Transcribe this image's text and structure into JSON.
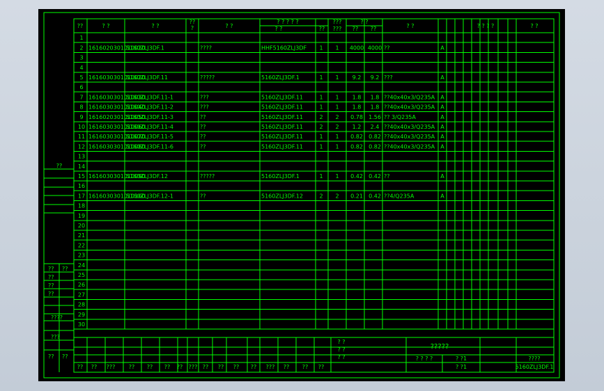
{
  "header": {
    "seq": "??",
    "code": "?  ?",
    "drawing_no": "?    ?",
    "qty_flag": "??\n?",
    "name": "?    ?",
    "assembly_top": "? ? ? ? ?",
    "assembly_sub_a": "?    ?",
    "assembly_sub_b": "??",
    "qty": "???\n???",
    "weight_top": "?    ?",
    "weight_single": "??",
    "weight_total": "??",
    "material": "?    ?",
    "extra": "?  ?  ?  ?",
    "remark": "?  ?"
  },
  "rows": [
    {
      "n": "1",
      "code": "",
      "drawing": "",
      "name": "",
      "asm": "",
      "q1": "",
      "q2": "",
      "w1": "",
      "w2": "",
      "mat": "",
      "cls": ""
    },
    {
      "n": "2",
      "code": "1616020301010020",
      "drawing": "5160ZLJ3DF.1",
      "name": "????",
      "asm": "HHF5160ZLJ3DF",
      "q1": "1",
      "q2": "1",
      "w1": "4000",
      "w2": "4000",
      "mat": "??",
      "cls": "A"
    },
    {
      "n": "3",
      "code": "",
      "drawing": "",
      "name": "",
      "asm": "",
      "q1": "",
      "q2": "",
      "w1": "",
      "w2": "",
      "mat": "",
      "cls": ""
    },
    {
      "n": "4",
      "code": "",
      "drawing": "",
      "name": "",
      "asm": "",
      "q1": "",
      "q2": "",
      "w1": "",
      "w2": "",
      "mat": "",
      "cls": ""
    },
    {
      "n": "5",
      "code": "1616030301010020",
      "drawing": "5160ZLJ3DF.11",
      "name": "?????",
      "asm": "5160ZLJ3DF.1",
      "q1": "1",
      "q2": "1",
      "w1": "9.2",
      "w2": "9.2",
      "mat": "???",
      "cls": "A"
    },
    {
      "n": "6",
      "code": "",
      "drawing": "",
      "name": "",
      "asm": "",
      "q1": "",
      "q2": "",
      "w1": "",
      "w2": "",
      "mat": "",
      "cls": ""
    },
    {
      "n": "7",
      "code": "1616030301010030",
      "drawing": "5160ZLJ3DF.11-1",
      "name": "???",
      "asm": "5160ZLJ3DF.11",
      "q1": "1",
      "q2": "1",
      "w1": "1.8",
      "w2": "1.8",
      "mat": "??40x40x3/Q235A",
      "cls": "A"
    },
    {
      "n": "8",
      "code": "1616030301010040",
      "drawing": "5160ZLJ3DF.11-2",
      "name": "???",
      "asm": "5160ZLJ3DF.11",
      "q1": "1",
      "q2": "1",
      "w1": "1.8",
      "w2": "1.8",
      "mat": "??40x40x3/Q235A",
      "cls": "A"
    },
    {
      "n": "9",
      "code": "1616020301010050",
      "drawing": "5160ZLJ3DF.11-3",
      "name": "??",
      "asm": "5160ZLJ3DF.11",
      "q1": "2",
      "q2": "2",
      "w1": "0.78",
      "w2": "1.56",
      "mat": "?? 3/Q235A",
      "cls": "A"
    },
    {
      "n": "10",
      "code": "1616030301010060",
      "drawing": "5160ZLJ3DF.11-4",
      "name": "??",
      "asm": "5160ZLJ3DF.11",
      "q1": "2",
      "q2": "2",
      "w1": "1.2",
      "w2": "2.4",
      "mat": "??40x40x3/Q235A",
      "cls": "A"
    },
    {
      "n": "11",
      "code": "1616030301010070",
      "drawing": "5160ZLJ3DF.11-5",
      "name": "??",
      "asm": "5160ZLJ3DF.11",
      "q1": "1",
      "q2": "1",
      "w1": "0.82",
      "w2": "0.82",
      "mat": "??40x40x3/Q235A",
      "cls": "A"
    },
    {
      "n": "12",
      "code": "1616030301010080",
      "drawing": "5160ZLJ3DF.11-6",
      "name": "??",
      "asm": "5160ZLJ3DF.11",
      "q1": "1",
      "q2": "1",
      "w1": "0.82",
      "w2": "0.82",
      "mat": "??40x40x3/Q235A",
      "cls": "A"
    },
    {
      "n": "13",
      "code": "",
      "drawing": "",
      "name": "",
      "asm": "",
      "q1": "",
      "q2": "",
      "w1": "",
      "w2": "",
      "mat": "",
      "cls": ""
    },
    {
      "n": "14",
      "code": "",
      "drawing": "",
      "name": "",
      "asm": "",
      "q1": "",
      "q2": "",
      "w1": "",
      "w2": "",
      "mat": "",
      "cls": ""
    },
    {
      "n": "15",
      "code": "1616030301010090",
      "drawing": "5160ZLJ3DF.12",
      "name": "?????",
      "asm": "5160ZLJ3DF.1",
      "q1": "1",
      "q2": "1",
      "w1": "0.42",
      "w2": "0.42",
      "mat": "??",
      "cls": "A"
    },
    {
      "n": "16",
      "code": "",
      "drawing": "",
      "name": "",
      "asm": "",
      "q1": "",
      "q2": "",
      "w1": "",
      "w2": "",
      "mat": "",
      "cls": ""
    },
    {
      "n": "17",
      "code": "1616030301010100",
      "drawing": "5160ZLJ3DF.12-1",
      "name": "??",
      "asm": "5160ZLJ3DF.12",
      "q1": "2",
      "q2": "2",
      "w1": "0.21",
      "w2": "0.42",
      "mat": "??4/Q235A",
      "cls": "A"
    },
    {
      "n": "18"
    },
    {
      "n": "19"
    },
    {
      "n": "20"
    },
    {
      "n": "21"
    },
    {
      "n": "22"
    },
    {
      "n": "23"
    },
    {
      "n": "24"
    },
    {
      "n": "25"
    },
    {
      "n": "26"
    },
    {
      "n": "27"
    },
    {
      "n": "28"
    },
    {
      "n": "29"
    },
    {
      "n": "30"
    }
  ],
  "left_strip": {
    "top_label": "??",
    "labels_a": [
      "??",
      "??"
    ],
    "labels_b": [
      "??",
      "??"
    ],
    "labels_c": [
      "??"
    ],
    "labels_d": [
      "??"
    ],
    "label_e": "????",
    "label_f": "???",
    "labels_g": [
      "??",
      "??"
    ]
  },
  "footer": {
    "bottom_labels": [
      "??",
      "??",
      "???",
      "??",
      "??",
      "??",
      "??",
      "???",
      "??",
      "??",
      "??",
      "??",
      "???",
      "??",
      "??",
      "??"
    ],
    "mid_labels": [
      "? ?",
      "? ?",
      "? ?"
    ],
    "title": "?????",
    "sig_a": "? ? ? ?",
    "sig_b": "? ?1",
    "sig_c": "? ?1",
    "code_label": "????",
    "drawing_no": "5160ZLJ3DF.1"
  }
}
